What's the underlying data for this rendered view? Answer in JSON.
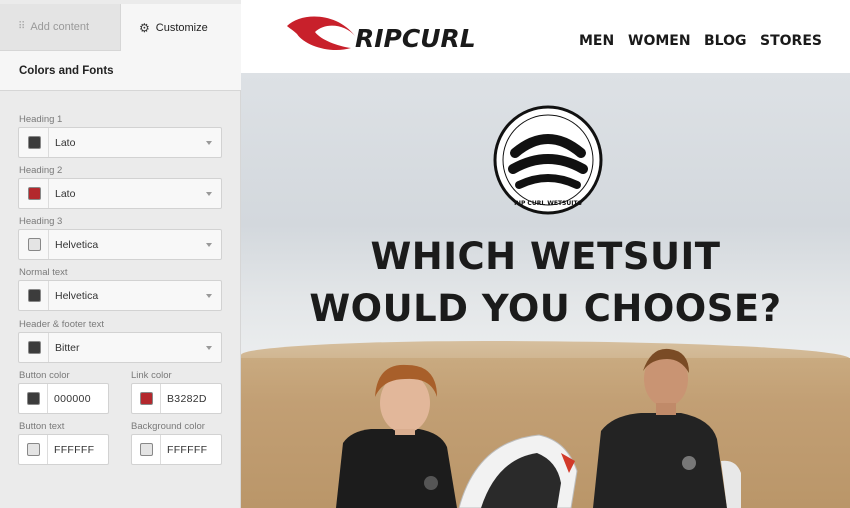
{
  "sidebar": {
    "tabs": [
      {
        "label": "Add content",
        "icon": "grid-icon",
        "active": false
      },
      {
        "label": "Customize",
        "icon": "gear-icon",
        "active": true
      }
    ],
    "section_title": "Colors and Fonts",
    "font_settings": [
      {
        "label": "Heading 1",
        "value": "Lato",
        "swatch": "#3c3c3c"
      },
      {
        "label": "Heading 2",
        "value": "Lato",
        "swatch": "#b3282d"
      },
      {
        "label": "Heading 3",
        "value": "Helvetica",
        "swatch": "#e4e4e4"
      },
      {
        "label": "Normal text",
        "value": "Helvetica",
        "swatch": "#3c3c3c"
      },
      {
        "label": "Header & footer text",
        "value": "Bitter",
        "swatch": "#3c3c3c"
      }
    ],
    "color_settings": [
      {
        "label": "Button color",
        "value": "000000",
        "swatch": "#3c3c3c"
      },
      {
        "label": "Link color",
        "value": "B3282D",
        "swatch": "#b3282d"
      },
      {
        "label": "Button text",
        "value": "FFFFFF",
        "swatch": "#e4e4e4"
      },
      {
        "label": "Background color",
        "value": "FFFFFF",
        "swatch": "#e4e4e4"
      }
    ]
  },
  "preview": {
    "brand_name": "RIPCURL",
    "nav": [
      "MEN",
      "WOMEN",
      "BLOG",
      "STORES"
    ],
    "badge_text": "RIP CURL WETSUITS",
    "headline_line1": "WHICH WETSUIT",
    "headline_line2": "WOULD YOU CHOOSE?"
  },
  "colors": {
    "brand_red": "#c8202b",
    "panel_bg": "#ebebeb",
    "headline": "#1b1b1b"
  }
}
